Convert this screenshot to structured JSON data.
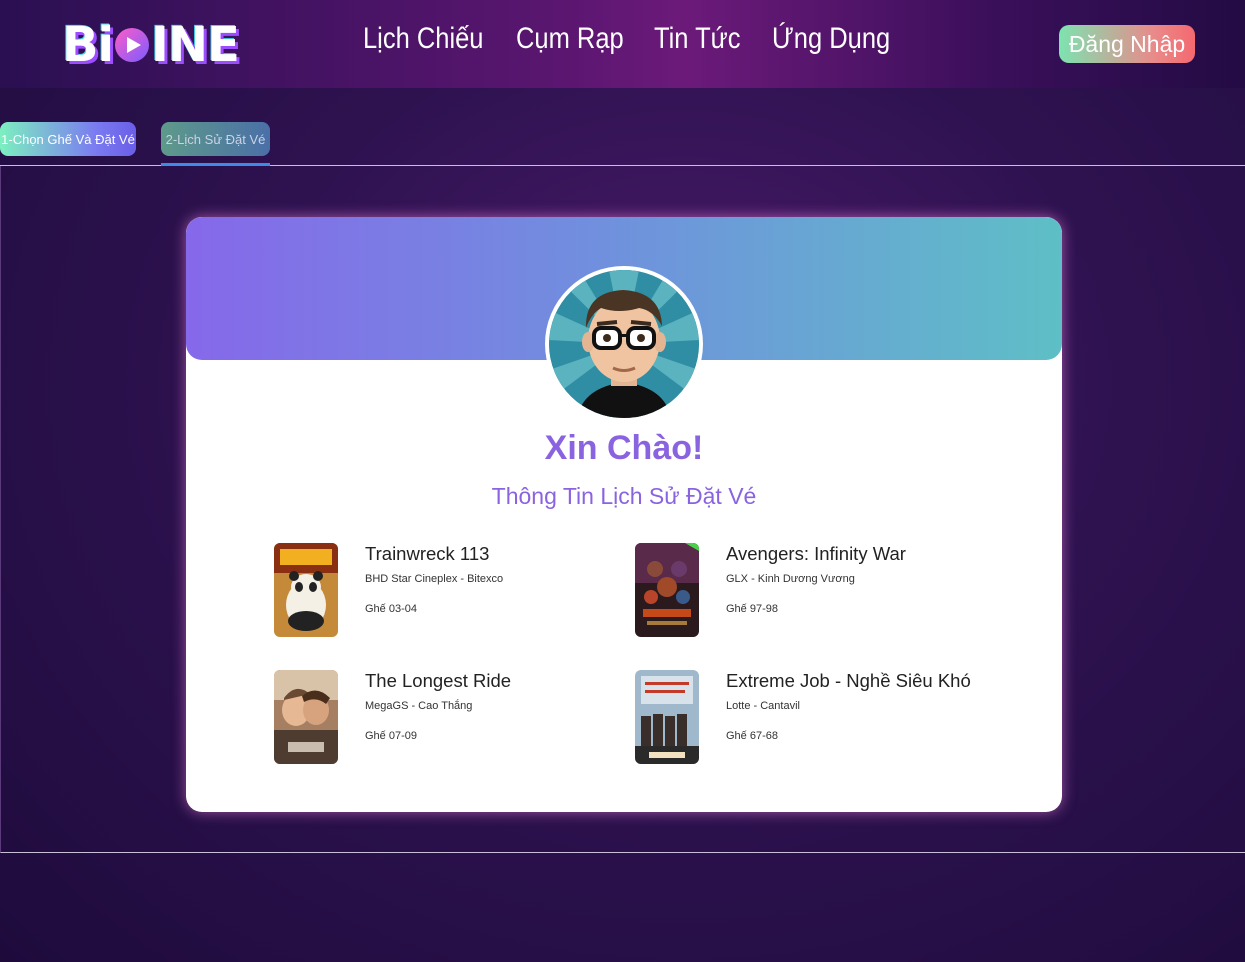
{
  "header": {
    "logo": "BiCINE",
    "logo_parts": [
      "Bi",
      "INE"
    ],
    "nav": [
      "Lịch Chiếu",
      "Cụm Rạp",
      "Tin Tức",
      "Ứng Dụng"
    ],
    "login_label": "Đăng Nhập"
  },
  "tabs": [
    {
      "label": "1-Chọn Ghế Và Đặt Vé",
      "active": false
    },
    {
      "label": "2-Lịch Sử Đặt Vé",
      "active": true
    }
  ],
  "profile": {
    "greeting": "Xin Chào!",
    "subtitle": "Thông Tin Lịch Sử Đặt Vé"
  },
  "tickets": [
    {
      "title": "Trainwreck 113",
      "cinema": "BHD Star Cineplex - Bitexco",
      "seats": "Ghế 03-04",
      "poster": "kung-fu-panda-poster"
    },
    {
      "title": "Avengers: Infinity War",
      "cinema": "GLX - Kinh Dương Vương",
      "seats": "Ghế 97-98",
      "poster": "avengers-poster"
    },
    {
      "title": "The Longest Ride",
      "cinema": "MegaGS - Cao Thắng",
      "seats": "Ghế 07-09",
      "poster": "longest-ride-poster"
    },
    {
      "title": "Extreme Job - Nghề Siêu Khó",
      "cinema": "Lotte - Cantavil",
      "seats": "Ghế 67-68",
      "poster": "extreme-job-poster"
    }
  ],
  "colors": {
    "accent_purple": "#8a63e0",
    "banner_start": "#8668ea",
    "banner_end": "#5ebfc6",
    "login_start": "#7de3b0",
    "login_end": "#f4696f"
  }
}
